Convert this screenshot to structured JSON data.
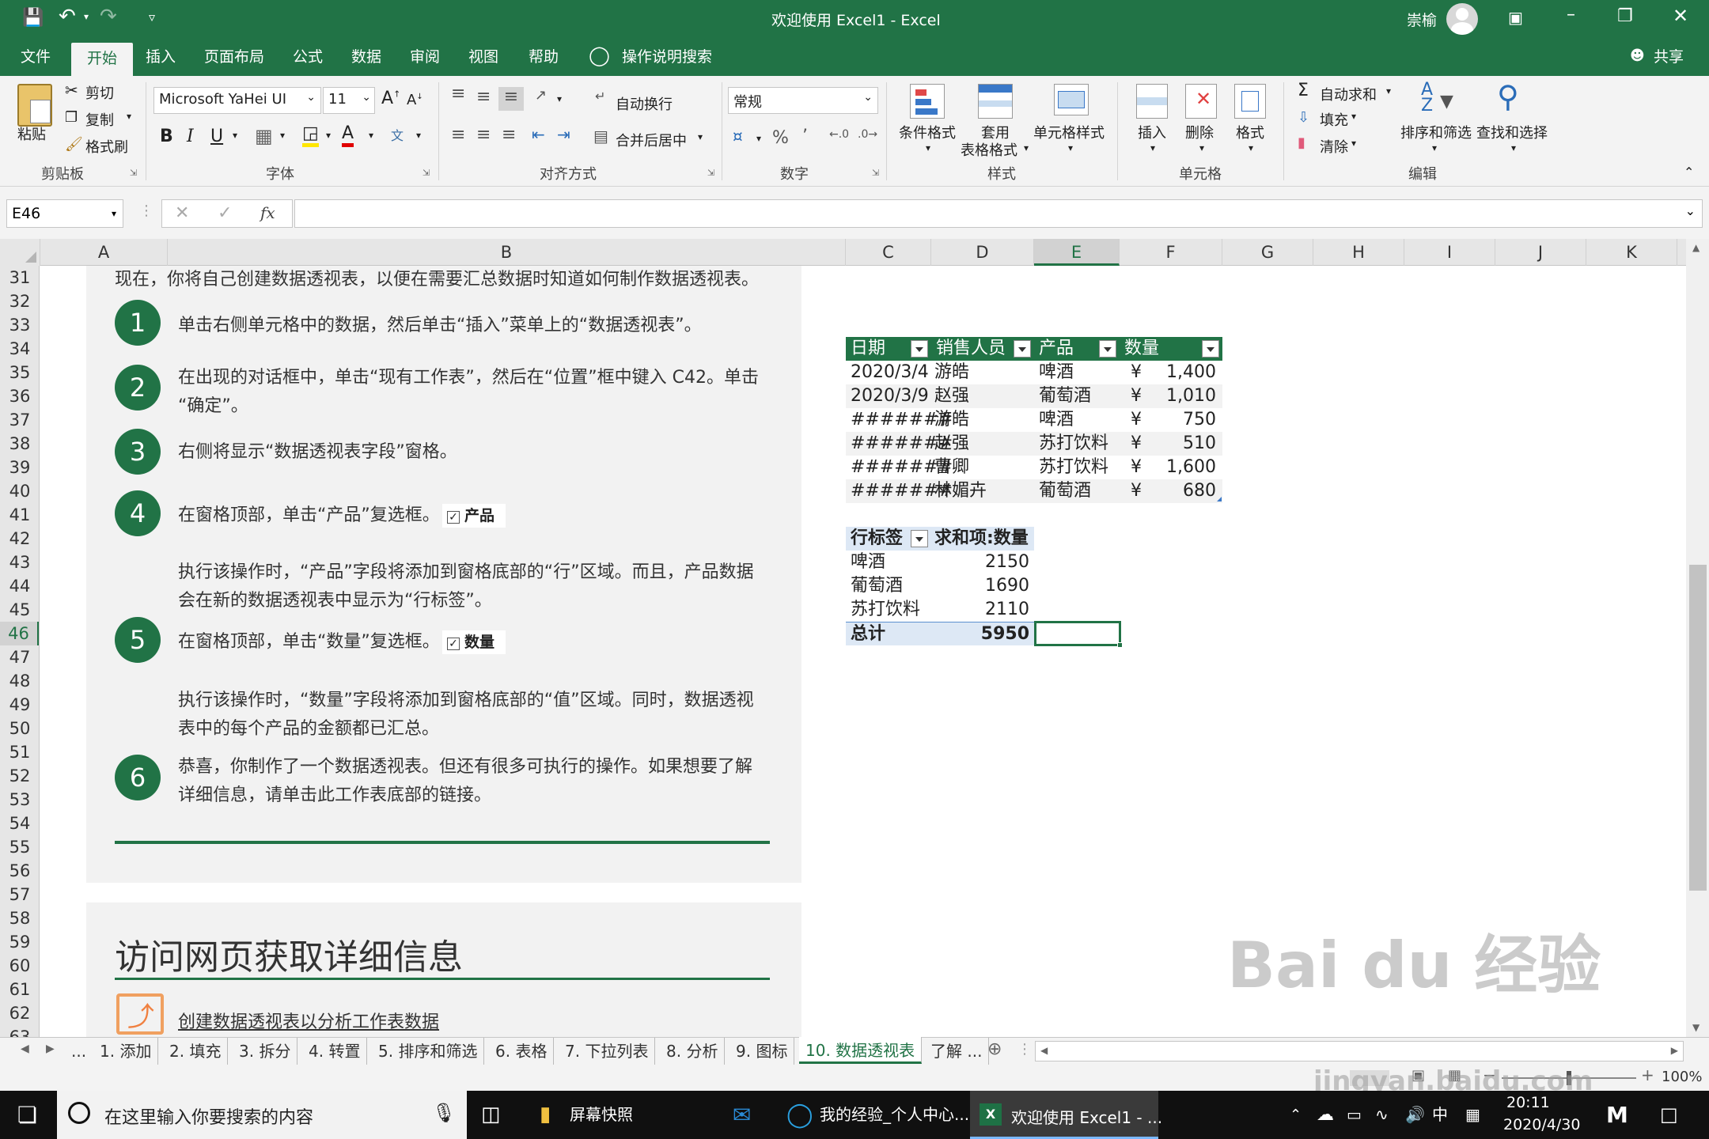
{
  "title": {
    "doc": "欢迎使用 Excel1",
    "sep": " - ",
    "app": "Excel",
    "user": "崇榆"
  },
  "tabs": [
    "文件",
    "开始",
    "插入",
    "页面布局",
    "公式",
    "数据",
    "审阅",
    "视图",
    "帮助"
  ],
  "tell_me": "操作说明搜索",
  "share": "共享",
  "ribbon": {
    "paste": "粘贴",
    "cut": "剪切",
    "copy": "复制",
    "format_painter": "格式刷",
    "clipboard": "剪贴板",
    "font_name": "Microsoft YaHei UI",
    "font_size": "11",
    "font_group": "字体",
    "wrap": "自动换行",
    "merge": "合并后居中",
    "align_group": "对齐方式",
    "num_format": "常规",
    "number_group": "数字",
    "cond_format": "条件格式",
    "table_format_1": "套用",
    "table_format_2": "表格格式",
    "cell_styles": "单元格样式",
    "styles_group": "样式",
    "insert": "插入",
    "delete": "删除",
    "format": "格式",
    "cells_group": "单元格",
    "autosum": "自动求和",
    "fill": "填充",
    "clear": "清除",
    "sort_filter": "排序和筛选",
    "find_select": "查找和选择",
    "edit_group": "编辑"
  },
  "name_box": "E46",
  "fx": "fx",
  "columns": [
    "A",
    "B",
    "C",
    "D",
    "E",
    "F",
    "G",
    "H",
    "I",
    "J",
    "K"
  ],
  "rows": [
    "31",
    "32",
    "33",
    "34",
    "35",
    "36",
    "37",
    "38",
    "39",
    "40",
    "41",
    "42",
    "43",
    "44",
    "45",
    "46",
    "47",
    "48",
    "49",
    "50",
    "51",
    "52",
    "53",
    "54",
    "55",
    "56",
    "57",
    "58",
    "59",
    "60",
    "61",
    "62",
    "63"
  ],
  "instructions": {
    "intro": "现在，你将自己创建数据透视表，以便在需要汇总数据时知道如何制作数据透视表。",
    "s1_num": "1",
    "s1": "单击右侧单元格中的数据，然后单击“插入”菜单上的“数据透视表”。",
    "s2_num": "2",
    "s2a": "在出现的对话框中，单击“现有工作表”，然后在“位置”框中键入 C42。单击",
    "s2b": "“确定”。",
    "s3_num": "3",
    "s3": "右侧将显示“数据透视表字段”窗格。",
    "s4_num": "4",
    "s4": "在窗格顶部，单击“产品”复选框。",
    "s4_chk": "产品",
    "s4_note_a": "执行该操作时，“产品”字段将添加到窗格底部的“行”区域。而且，产品数据",
    "s4_note_b": "会在新的数据透视表中显示为“行标签”。",
    "s5_num": "5",
    "s5": "在窗格顶部，单击“数量”复选框。",
    "s5_chk": "数量",
    "s5_note_a": "执行该操作时，“数量”字段将添加到窗格底部的“值”区域。同时，数据透视",
    "s5_note_b": "表中的每个产品的金额都已汇总。",
    "s6_num": "6",
    "s6a": "恭喜，你制作了一个数据透视表。但还有很多可执行的操作。如果想要了解",
    "s6b": "详细信息，请单击此工作表底部的链接。",
    "more_title": "访问网页获取详细信息",
    "link": "创建数据透视表以分析工作表数据"
  },
  "source_table": {
    "headers": [
      "日期",
      "销售人员",
      "产品",
      "数量"
    ],
    "rows": [
      {
        "date": "2020/3/4",
        "person": "游皓",
        "product": "啤酒",
        "cur": "¥",
        "qty": "1,400"
      },
      {
        "date": "2020/3/9",
        "person": "赵强",
        "product": "葡萄酒",
        "cur": "¥",
        "qty": "1,010"
      },
      {
        "date": "#######",
        "person": "游皓",
        "product": "啤酒",
        "cur": "¥",
        "qty": "750"
      },
      {
        "date": "#######",
        "person": "赵强",
        "product": "苏打饮料",
        "cur": "¥",
        "qty": "510"
      },
      {
        "date": "#######",
        "person": "曹卿",
        "product": "苏打饮料",
        "cur": "¥",
        "qty": "1,600"
      },
      {
        "date": "#######",
        "person": "林媚卉",
        "product": "葡萄酒",
        "cur": "¥",
        "qty": "680"
      }
    ]
  },
  "pivot": {
    "row_label": "行标签",
    "sum_label": "求和项:数量",
    "rows": [
      {
        "label": "啤酒",
        "value": "2150"
      },
      {
        "label": "葡萄酒",
        "value": "1690"
      },
      {
        "label": "苏打饮料",
        "value": "2110"
      }
    ],
    "total_label": "总计",
    "total_value": "5950"
  },
  "sheet_tabs": [
    "...",
    "1. 添加",
    "2. 填充",
    "3. 拆分",
    "4. 转置",
    "5. 排序和筛选",
    "6. 表格",
    "7. 下拉列表",
    "8. 分析",
    "9. 图标",
    "10. 数据透视表",
    "了解 ..."
  ],
  "zoom": "100%",
  "watermark": {
    "logo": "Bai du 经验",
    "url": "jingyan.baidu.com"
  },
  "taskbar": {
    "search": "在这里输入你要搜索的内容",
    "app1": "屏幕快照",
    "app2": "我的经验_个人中心...",
    "app3": "欢迎使用 Excel1 - ...",
    "ime": "中",
    "time": "20:11",
    "date": "2020/4/30"
  }
}
